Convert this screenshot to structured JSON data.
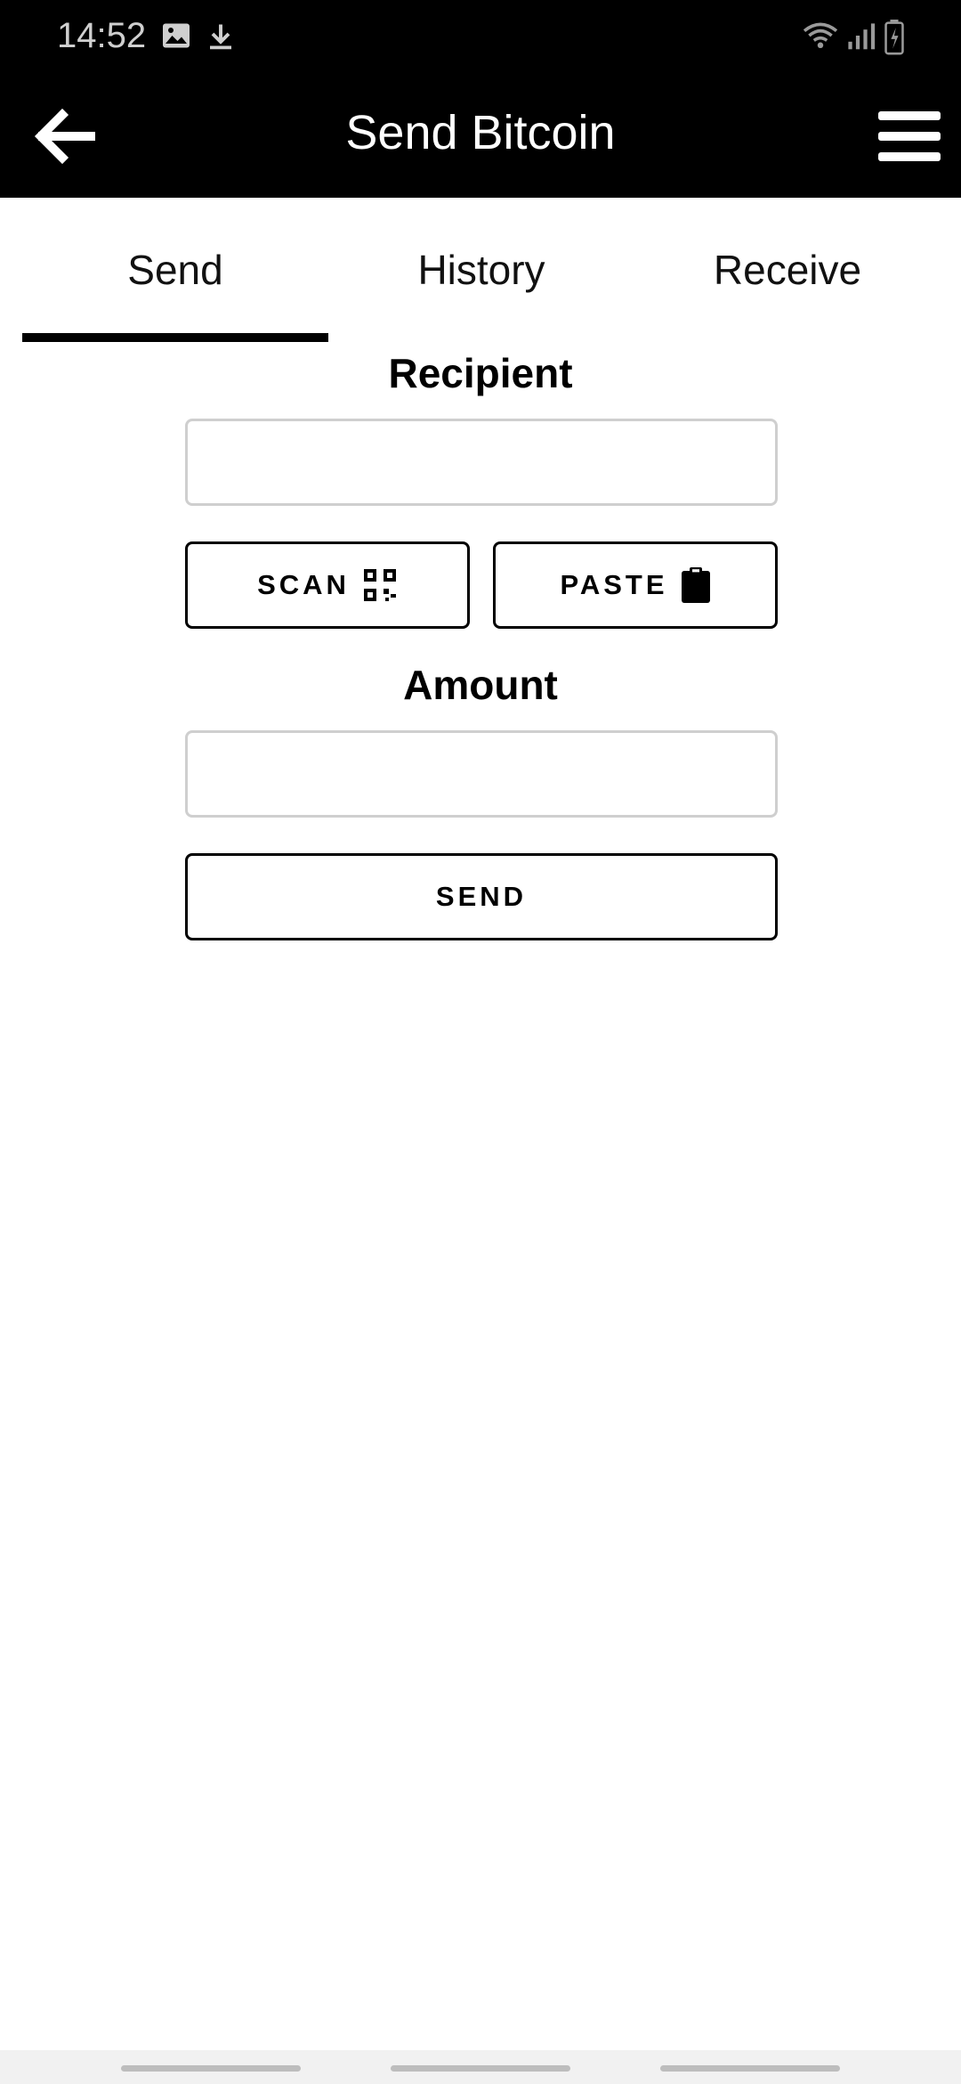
{
  "status_bar": {
    "time": "14:52",
    "icons": [
      "image-icon",
      "download-icon",
      "wifi-icon",
      "signal-icon",
      "battery-icon"
    ]
  },
  "app_bar": {
    "title": "Send Bitcoin",
    "back_icon": "arrow-left-icon",
    "menu_icon": "hamburger-menu-icon"
  },
  "tabs": [
    {
      "label": "Send",
      "selected": true
    },
    {
      "label": "History",
      "selected": false
    },
    {
      "label": "Receive",
      "selected": false
    }
  ],
  "form": {
    "recipient_label": "Recipient",
    "recipient_value": "",
    "scan_label": "SCAN",
    "scan_icon": "qr-code-icon",
    "paste_label": "PASTE",
    "paste_icon": "clipboard-icon",
    "amount_label": "Amount",
    "amount_value": "",
    "send_label": "SEND"
  },
  "colors": {
    "bar_background": "#000000",
    "accent": "#000000",
    "input_border": "#cfcfcf"
  }
}
